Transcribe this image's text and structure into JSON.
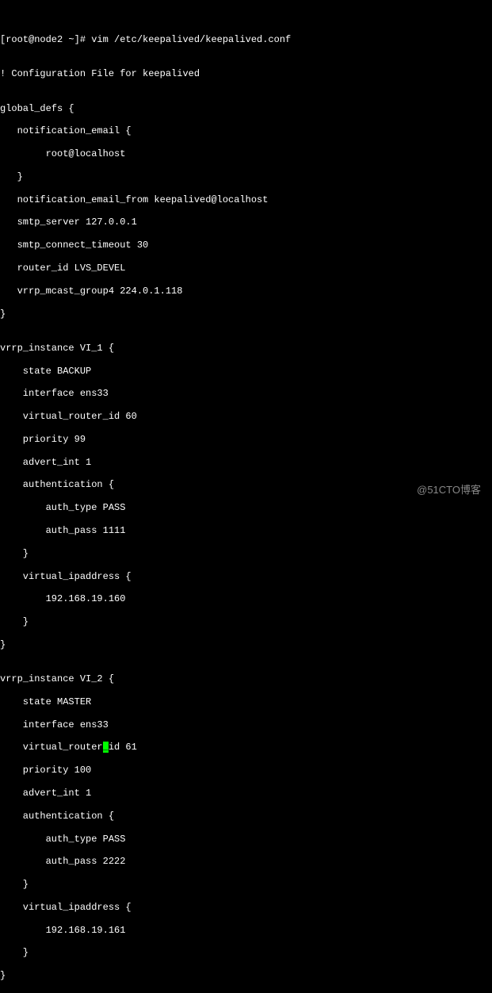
{
  "terminal": {
    "prompt_line": "[root@node2 ~]# vim /etc/keepalived/keepalived.conf",
    "top_partial": "                                                    ",
    "blank": "",
    "config_header": "! Configuration File for keepalived",
    "global_defs_open": "global_defs {",
    "notification_email_open": "   notification_email {",
    "root_localhost": "        root@localhost",
    "close_brace_3": "   }",
    "notification_email_from": "   notification_email_from keepalived@localhost",
    "smtp_server": "   smtp_server 127.0.0.1",
    "smtp_timeout": "   smtp_connect_timeout 30",
    "router_id": "   router_id LVS_DEVEL",
    "vrrp_mcast": "   vrrp_mcast_group4 224.0.1.118",
    "close_brace_0": "}",
    "vi1_open": "vrrp_instance VI_1 {",
    "vi1_state": "    state BACKUP",
    "vi1_interface": "    interface ens33",
    "vi1_router_id": "    virtual_router_id 60",
    "vi1_priority": "    priority 99",
    "vi1_advert": "    advert_int 1",
    "vi1_auth_open": "    authentication {",
    "vi1_auth_type": "        auth_type PASS",
    "vi1_auth_pass": "        auth_pass 1111",
    "vi1_auth_close": "    }",
    "vi1_vip_open": "    virtual_ipaddress {",
    "vi1_vip": "        192.168.19.160",
    "vi1_vip_close": "    }",
    "vi2_open": "vrrp_instance VI_2 {",
    "vi2_state": "    state MASTER",
    "vi2_interface": "    interface ens33",
    "vi2_router_pre": "    virtual_router",
    "vi2_router_cursor": "_",
    "vi2_router_post": "id 61",
    "vi2_priority": "    priority 100",
    "vi2_advert": "    advert_int 1",
    "vi2_auth_open": "    authentication {",
    "vi2_auth_type": "        auth_type PASS",
    "vi2_auth_pass": "        auth_pass 2222",
    "vi2_auth_close": "    }",
    "vi2_vip_open": "    virtual_ipaddress {",
    "vi2_vip": "        192.168.19.161",
    "vi2_vip_close": "    }"
  },
  "watermark": "@51CTO博客"
}
